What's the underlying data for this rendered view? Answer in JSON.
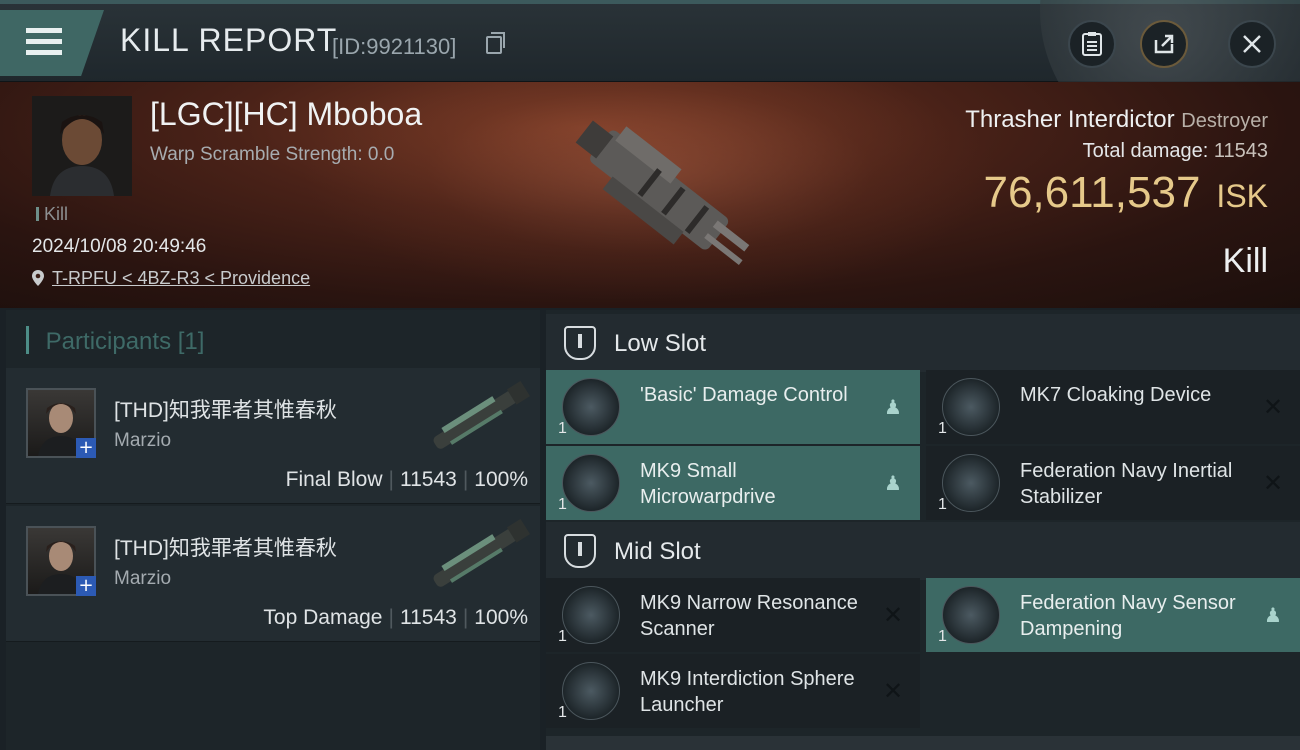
{
  "header": {
    "title": "KILL REPORT",
    "report_id": "[ID:9921130]",
    "icons": [
      "menu-icon",
      "copy-icon",
      "clipboard-icon",
      "share-icon",
      "close-icon"
    ]
  },
  "victim": {
    "name": "[LGC][HC] Mboboa",
    "warp_scramble": "Warp Scramble Strength: 0.0",
    "tag": "Kill",
    "datetime": "2024/10/08 20:49:46",
    "location": "T-RPFU < 4BZ-R3 < Providence"
  },
  "ship": {
    "name": "Thrasher Interdictor",
    "class": "Destroyer",
    "total_damage_label": "Total damage:",
    "total_damage": "11543",
    "isk_value": "76,611,537",
    "isk_unit": "ISK",
    "result": "Kill"
  },
  "participants": {
    "label": "Participants",
    "count": "[1]",
    "rows": [
      {
        "name": "[THD]知我罪者其惟春秋",
        "corp": "Marzio",
        "role": "Final Blow",
        "damage": "11543",
        "percent": "100%"
      },
      {
        "name": "[THD]知我罪者其惟春秋",
        "corp": "Marzio",
        "role": "Top Damage",
        "damage": "11543",
        "percent": "100%"
      }
    ]
  },
  "slots": {
    "low": {
      "label": "Low Slot",
      "modules": [
        {
          "qty": "1",
          "name": "'Basic' Damage Control",
          "status": "dropped"
        },
        {
          "qty": "1",
          "name": "MK7 Cloaking Device",
          "status": "destroyed"
        },
        {
          "qty": "1",
          "name": "MK9 Small Microwarpdrive",
          "status": "dropped"
        },
        {
          "qty": "1",
          "name": "Federation Navy Inertial Stabilizer",
          "status": "destroyed"
        }
      ]
    },
    "mid": {
      "label": "Mid Slot",
      "modules": [
        {
          "qty": "1",
          "name": "MK9 Narrow Resonance Scanner",
          "status": "destroyed"
        },
        {
          "qty": "1",
          "name": "Federation Navy Sensor Dampening",
          "status": "dropped"
        },
        {
          "qty": "1",
          "name": "MK9 Interdiction Sphere Launcher",
          "status": "destroyed"
        }
      ]
    }
  },
  "colors": {
    "accent_teal": "#3d6964",
    "isk_gold": "#e6c98a",
    "corp_badge": "#2c5ab4"
  }
}
